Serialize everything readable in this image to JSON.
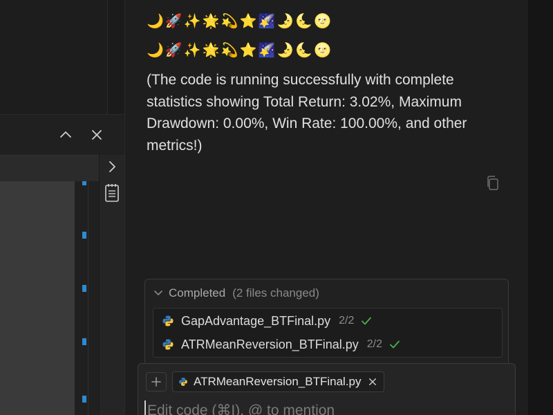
{
  "chat": {
    "emoji_rows": [
      "🌙🚀✨🌟💫⭐🌠🌛🌜🌝",
      "🌙🚀✨🌟💫⭐🌠🌛🌜🌝"
    ],
    "message": "(The code is running successfully with complete statistics showing Total Return: 3.02%, Maximum Drawdown: 0.00%, Win Rate: 100.00%, and other metrics!)"
  },
  "completed": {
    "title": "Completed",
    "count_label": "(2 files changed)",
    "files": [
      {
        "name": "GapAdvantage_BTFinal.py",
        "ratio": "2/2"
      },
      {
        "name": "ATRMeanReversion_BTFinal.py",
        "ratio": "2/2"
      }
    ]
  },
  "composer": {
    "context_file": "ATRMeanReversion_BTFinal.py",
    "placeholder": "Edit code (⌘I), @ to mention"
  },
  "colors": {
    "accent_blue": "#2d8bd1",
    "success_green": "#4caf50",
    "python_blue": "#3b7bbf",
    "python_yellow": "#f2c744"
  },
  "icons": [
    "chevron-up-icon",
    "close-icon",
    "chevron-right-icon",
    "notes-icon",
    "copy-icon",
    "chevron-down-icon",
    "python-icon",
    "check-icon",
    "plus-icon"
  ]
}
